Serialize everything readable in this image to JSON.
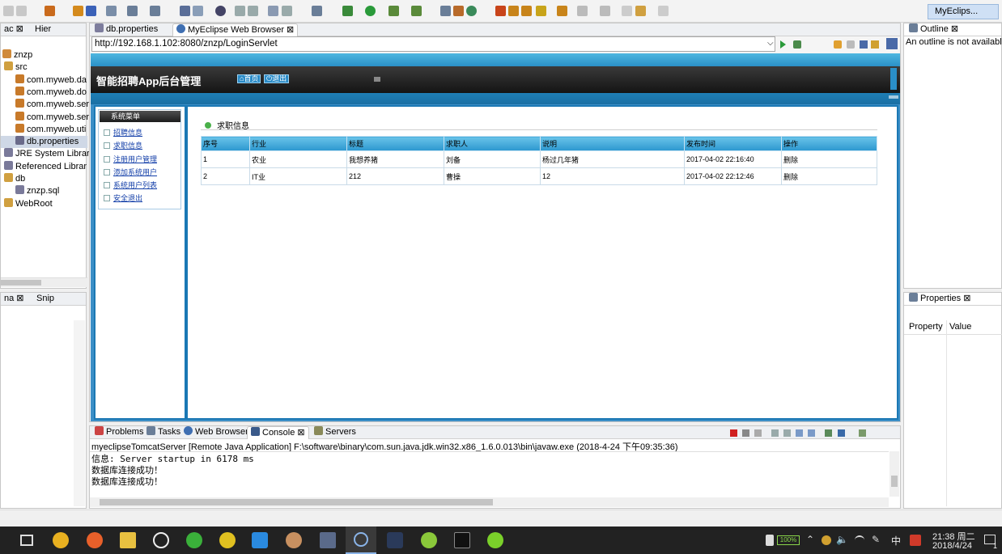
{
  "toolbar": {
    "perspective_label": "MyEclips..."
  },
  "left_top_panel": {
    "tabs": [
      "ac",
      "Hier"
    ],
    "tree": [
      {
        "label": "znzp",
        "indent": 0
      },
      {
        "label": "src",
        "indent": 1
      },
      {
        "label": "com.myweb.da",
        "indent": 2
      },
      {
        "label": "com.myweb.do",
        "indent": 2
      },
      {
        "label": "com.myweb.ser",
        "indent": 2
      },
      {
        "label": "com.myweb.ser",
        "indent": 2
      },
      {
        "label": "com.myweb.uti",
        "indent": 2
      },
      {
        "label": "db.properties",
        "indent": 2
      },
      {
        "label": "JRE System Library",
        "indent": 1
      },
      {
        "label": "Referenced Librar",
        "indent": 1
      },
      {
        "label": "db",
        "indent": 1
      },
      {
        "label": "znzp.sql",
        "indent": 2
      },
      {
        "label": "WebRoot",
        "indent": 1
      }
    ]
  },
  "left_bottom_panel": {
    "tabs": [
      "na",
      "Snip"
    ]
  },
  "editor": {
    "tabs": [
      "db.properties",
      "MyEclipse Web Browser"
    ],
    "url": "http://192.168.1.102:8080/znzp/LoginServlet"
  },
  "webapp": {
    "title": "智能招聘App后台管理",
    "nav": [
      "首页",
      "退出"
    ],
    "menu_header": "系统菜单",
    "menu_items": [
      "招聘信息",
      "求职信息",
      "注册用户管理",
      "添加系统用户",
      "系统用户列表",
      "安全退出"
    ],
    "section_title": "求职信息",
    "table": {
      "headers": [
        "序号",
        "行业",
        "标题",
        "求职人",
        "说明",
        "发布时间",
        "操作"
      ],
      "rows": [
        [
          "1",
          "农业",
          "我想养猪",
          "刘备",
          "杨过几年猪",
          "2017-04-02 22:16:40",
          "删除"
        ],
        [
          "2",
          "IT业",
          "212",
          "曹操",
          "12",
          "2017-04-02 22:12:46",
          "删除"
        ]
      ]
    }
  },
  "outline": {
    "tab": "Outline",
    "message": "An outline is not available"
  },
  "properties": {
    "tab": "Properties",
    "col_property": "Property",
    "col_value": "Value"
  },
  "console_panel": {
    "tabs": [
      "Problems",
      "Tasks",
      "Web Browser",
      "Console",
      "Servers"
    ],
    "header": "myeclipseTomcatServer [Remote Java Application] F:\\software\\binary\\com.sun.java.jdk.win32.x86_1.6.0.013\\bin\\javaw.exe (2018-4-24 下午09:35:36)",
    "lines": [
      "信息: Server startup in 6178 ms",
      "数据库连接成功！",
      "数据库连接成功！"
    ]
  },
  "taskbar": {
    "time": "21:38 周二",
    "date": "2018/4/24",
    "battery": "100%",
    "ime": "中",
    "notify_count": "1"
  }
}
